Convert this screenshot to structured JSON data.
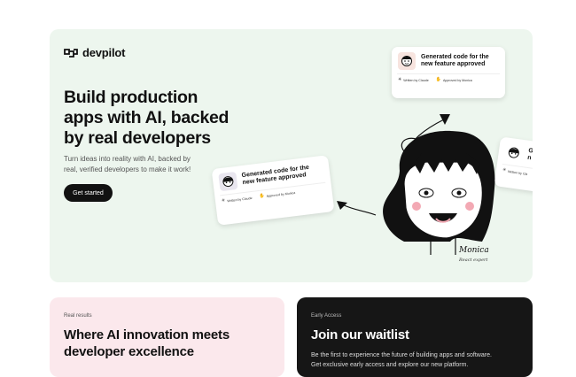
{
  "brand": {
    "name": "devpilot",
    "logo_icon": "devpilot-logo-icon"
  },
  "hero": {
    "headline_lines": [
      "Build production",
      "apps with AI, backed",
      "by real developers"
    ],
    "subtext_lines": [
      "Turn ideas into reality with AI, backed by",
      "real, verified developers to make it work!"
    ],
    "cta_label": "Get started",
    "background": "#edf6ee"
  },
  "cards": [
    {
      "title_lines": [
        "Generated code for the",
        "new feature approved"
      ],
      "written_by": "Written by Claude",
      "approved_by": "Approved by Monica"
    },
    {
      "title_lines": [
        "Generated code for the",
        "new feature approved"
      ],
      "written_by": "Written by Claude",
      "approved_by": "Approved by Monica"
    },
    {
      "title_lines": [
        "G",
        "n"
      ],
      "written_by": "Written by Cla",
      "approved_by": ""
    }
  ],
  "illustration": {
    "signature": "Monica",
    "role": "React expert"
  },
  "results_panel": {
    "eyebrow": "Real results",
    "heading_lines": [
      "Where AI innovation meets",
      "developer excellence"
    ],
    "background": "#fbe8ec"
  },
  "waitlist_panel": {
    "eyebrow": "Early Access",
    "heading": "Join our waitlist",
    "body_lines": [
      "Be the first to experience the future of building apps and software.",
      "Get exclusive early access and explore our new platform."
    ],
    "background": "#161616"
  }
}
